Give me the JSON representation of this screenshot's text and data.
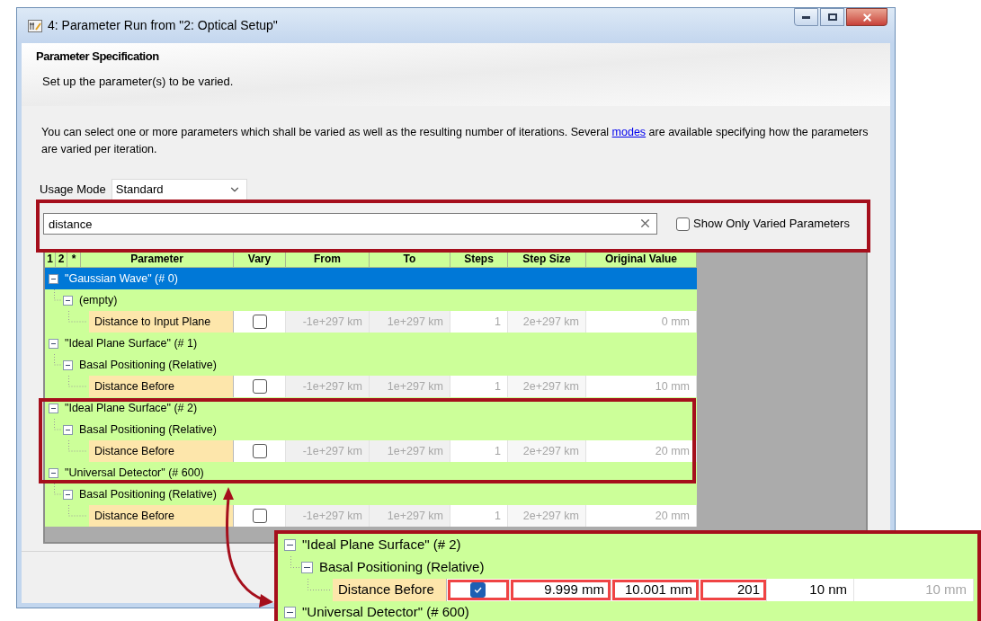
{
  "window": {
    "title": "4: Parameter Run from \"2: Optical Setup\""
  },
  "header": {
    "title": "Parameter Specification",
    "subtitle": "Set up the parameter(s) to be varied."
  },
  "intro": {
    "before": "You can select one or more parameters which shall be varied as well as the resulting number of iterations. Several ",
    "link": "modes",
    "after": " are available specifying how the parameters are varied per iteration."
  },
  "usage_mode": {
    "label": "Usage Mode",
    "value": "Standard"
  },
  "search": {
    "value": "distance"
  },
  "show_only_varied": {
    "label": "Show Only Varied Parameters",
    "checked": false
  },
  "table": {
    "columns": [
      "1",
      "2",
      "*",
      "Parameter",
      "Vary",
      "From",
      "To",
      "Steps",
      "Step Size",
      "Original Value"
    ],
    "tree": [
      {
        "label": "\"Gaussian Wave\" (# 0)",
        "selected": true,
        "expanded": true,
        "children": [
          {
            "label": "(empty)",
            "expanded": true,
            "children": [
              {
                "parameter": "Distance to Input Plane",
                "vary": false,
                "from": "-1e+297 km",
                "to": "1e+297 km",
                "steps": "1",
                "step_size": "2e+297 km",
                "original_value": "0 mm"
              }
            ]
          }
        ]
      },
      {
        "label": "\"Ideal Plane Surface\" (# 1)",
        "selected": false,
        "expanded": true,
        "children": [
          {
            "label": "Basal Positioning (Relative)",
            "expanded": true,
            "children": [
              {
                "parameter": "Distance Before",
                "vary": false,
                "from": "-1e+297 km",
                "to": "1e+297 km",
                "steps": "1",
                "step_size": "2e+297 km",
                "original_value": "10 mm"
              }
            ]
          }
        ]
      },
      {
        "label": "\"Ideal Plane Surface\" (# 2)",
        "selected": false,
        "expanded": true,
        "children": [
          {
            "label": "Basal Positioning (Relative)",
            "expanded": true,
            "children": [
              {
                "parameter": "Distance Before",
                "vary": false,
                "from": "-1e+297 km",
                "to": "1e+297 km",
                "steps": "1",
                "step_size": "2e+297 km",
                "original_value": "20 mm"
              }
            ]
          }
        ]
      },
      {
        "label": "\"Universal Detector\" (# 600)",
        "selected": false,
        "expanded": true,
        "children": [
          {
            "label": "Basal Positioning (Relative)",
            "expanded": true,
            "children": [
              {
                "parameter": "Distance Before",
                "vary": false,
                "from": "-1e+297 km",
                "to": "1e+297 km",
                "steps": "1",
                "step_size": "2e+297 km",
                "original_value": "20 mm"
              }
            ]
          }
        ]
      }
    ]
  },
  "callout": {
    "tree": [
      {
        "label": "\"Ideal Plane Surface\" (# 2)",
        "selected": false,
        "expanded": true,
        "children": [
          {
            "label": "Basal Positioning (Relative)",
            "expanded": true,
            "children": [
              {
                "parameter": "Distance Before",
                "vary": true,
                "from": "9.999 mm",
                "to": "10.001 mm",
                "steps": "201",
                "step_size": "10 nm",
                "original_value": "10 mm"
              }
            ]
          }
        ]
      },
      {
        "label": "\"Universal Detector\" (# 600)",
        "selected": false,
        "expanded": true
      }
    ]
  }
}
